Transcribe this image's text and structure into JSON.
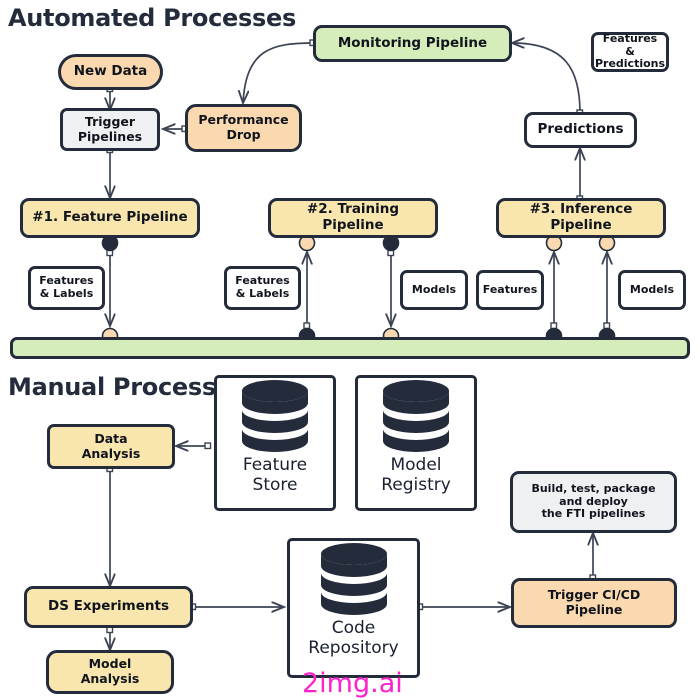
{
  "sections": {
    "automated": "Automated Processes",
    "manual": "Manual Processes"
  },
  "colors": {
    "peach": "#fad8b0",
    "yellow": "#f9e6ae",
    "green": "#d5edbb",
    "grey": "#eff0f2",
    "white": "#ffffff",
    "stroke": "#242c3c",
    "watermark": "#ff22cc"
  },
  "automated": {
    "new_data": "New Data",
    "trigger_pipelines": "Trigger\nPipelines",
    "performance_drop": "Performance\nDrop",
    "monitoring_pipeline": "Monitoring Pipeline",
    "features_predictions": "Features\n& Predictions",
    "predictions": "Predictions",
    "feature_pipeline": "#1. Feature Pipeline",
    "training_pipeline": "#2. Training Pipeline",
    "inference_pipeline": "#3. Inference Pipeline",
    "artifacts": [
      {
        "label": "Features\n& Labels"
      },
      {
        "label": "Features\n& Labels"
      },
      {
        "label": "Models"
      },
      {
        "label": "Features"
      },
      {
        "label": "Models"
      }
    ],
    "bus_bar": ""
  },
  "manual": {
    "data_analysis": "Data\nAnalysis",
    "ds_experiments": "DS Experiments",
    "model_analysis": "Model\nAnalysis",
    "feature_store": "Feature\nStore",
    "model_registry": "Model\nRegistry",
    "code_repository": "Code\nRepository",
    "build_deploy": "Build, test, package\nand deploy\nthe FTI pipelines",
    "trigger_cicd": "Trigger CI/CD\nPipeline"
  },
  "watermark": "2img.ai"
}
